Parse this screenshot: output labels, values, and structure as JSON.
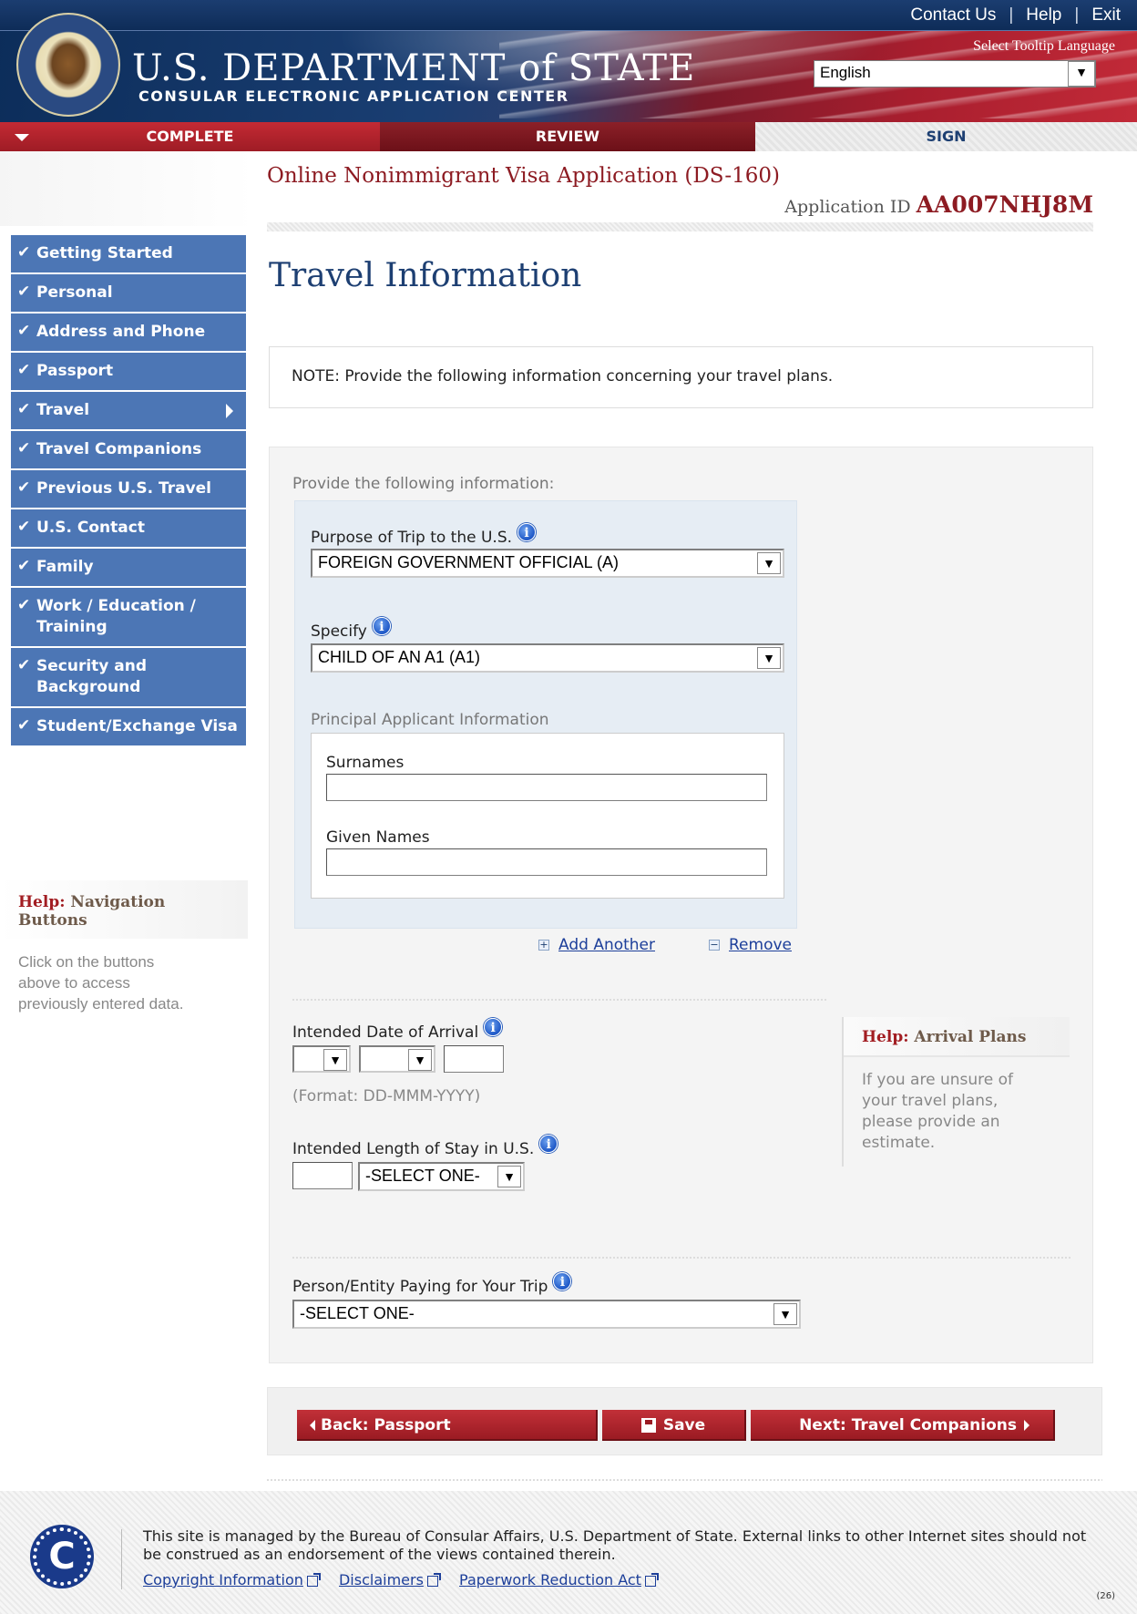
{
  "header": {
    "links": [
      "Contact Us",
      "Help",
      "Exit"
    ],
    "brand_title": "U.S. DEPARTMENT of STATE",
    "brand_subtitle": "CONSULAR ELECTRONIC APPLICATION CENTER",
    "tooltip_language_label": "Select Tooltip Language",
    "tooltip_language_value": "English"
  },
  "steps": {
    "complete": "COMPLETE",
    "review": "REVIEW",
    "sign": "SIGN"
  },
  "sidebar": {
    "items": [
      {
        "label": "Getting Started"
      },
      {
        "label": "Personal"
      },
      {
        "label": "Address and Phone"
      },
      {
        "label": "Passport"
      },
      {
        "label": "Travel"
      },
      {
        "label": "Travel Companions"
      },
      {
        "label": "Previous U.S. Travel"
      },
      {
        "label": "U.S. Contact"
      },
      {
        "label": "Family"
      },
      {
        "label": "Work / Education / Training"
      },
      {
        "label": "Security and Background"
      },
      {
        "label": "Student/Exchange Visa"
      }
    ],
    "help_title_prefix": "Help:",
    "help_title": "Navigation Buttons",
    "help_body": "Click on the buttons above to access previously entered data."
  },
  "main": {
    "app_title": "Online Nonimmigrant Visa Application (DS-160)",
    "app_id_label": "Application ID",
    "app_id": "AA007NHJ8M",
    "heading": "Travel Information",
    "note": "NOTE: Provide the following information concerning your travel plans.",
    "provide_label": "Provide the following information:",
    "purpose_label": "Purpose of Trip to the U.S.",
    "purpose_value": "FOREIGN GOVERNMENT OFFICIAL (A)",
    "specify_label": "Specify",
    "specify_value": "CHILD OF AN A1 (A1)",
    "principal_label": "Principal Applicant Information",
    "surnames_label": "Surnames",
    "given_names_label": "Given Names",
    "add_another": "Add Another",
    "remove": "Remove",
    "arrival_label": "Intended Date of Arrival",
    "date_format": "(Format: DD-MMM-YYYY)",
    "stay_label": "Intended Length of Stay in U.S.",
    "stay_unit_value": "-SELECT ONE-",
    "payer_label": "Person/Entity Paying for Your Trip",
    "payer_value": "-SELECT ONE-",
    "help_arrival_prefix": "Help:",
    "help_arrival_title": "Arrival Plans",
    "help_arrival_body": "If you are unsure of your travel plans, please provide an estimate."
  },
  "buttons": {
    "back": "Back: Passport",
    "save": "Save",
    "next": "Next: Travel Companions"
  },
  "footer": {
    "text": "This site is managed by the Bureau of Consular Affairs, U.S. Department of State. External links to other Internet sites should not be construed as an endorsement of the views contained therein.",
    "links": [
      "Copyright Information",
      "Disclaimers",
      "Paperwork Reduction Act"
    ],
    "build": "(26)"
  },
  "colors": {
    "nav_blue": "#4c76b5",
    "brand_red": "#8d1b22",
    "heading_blue": "#1d3f72"
  }
}
